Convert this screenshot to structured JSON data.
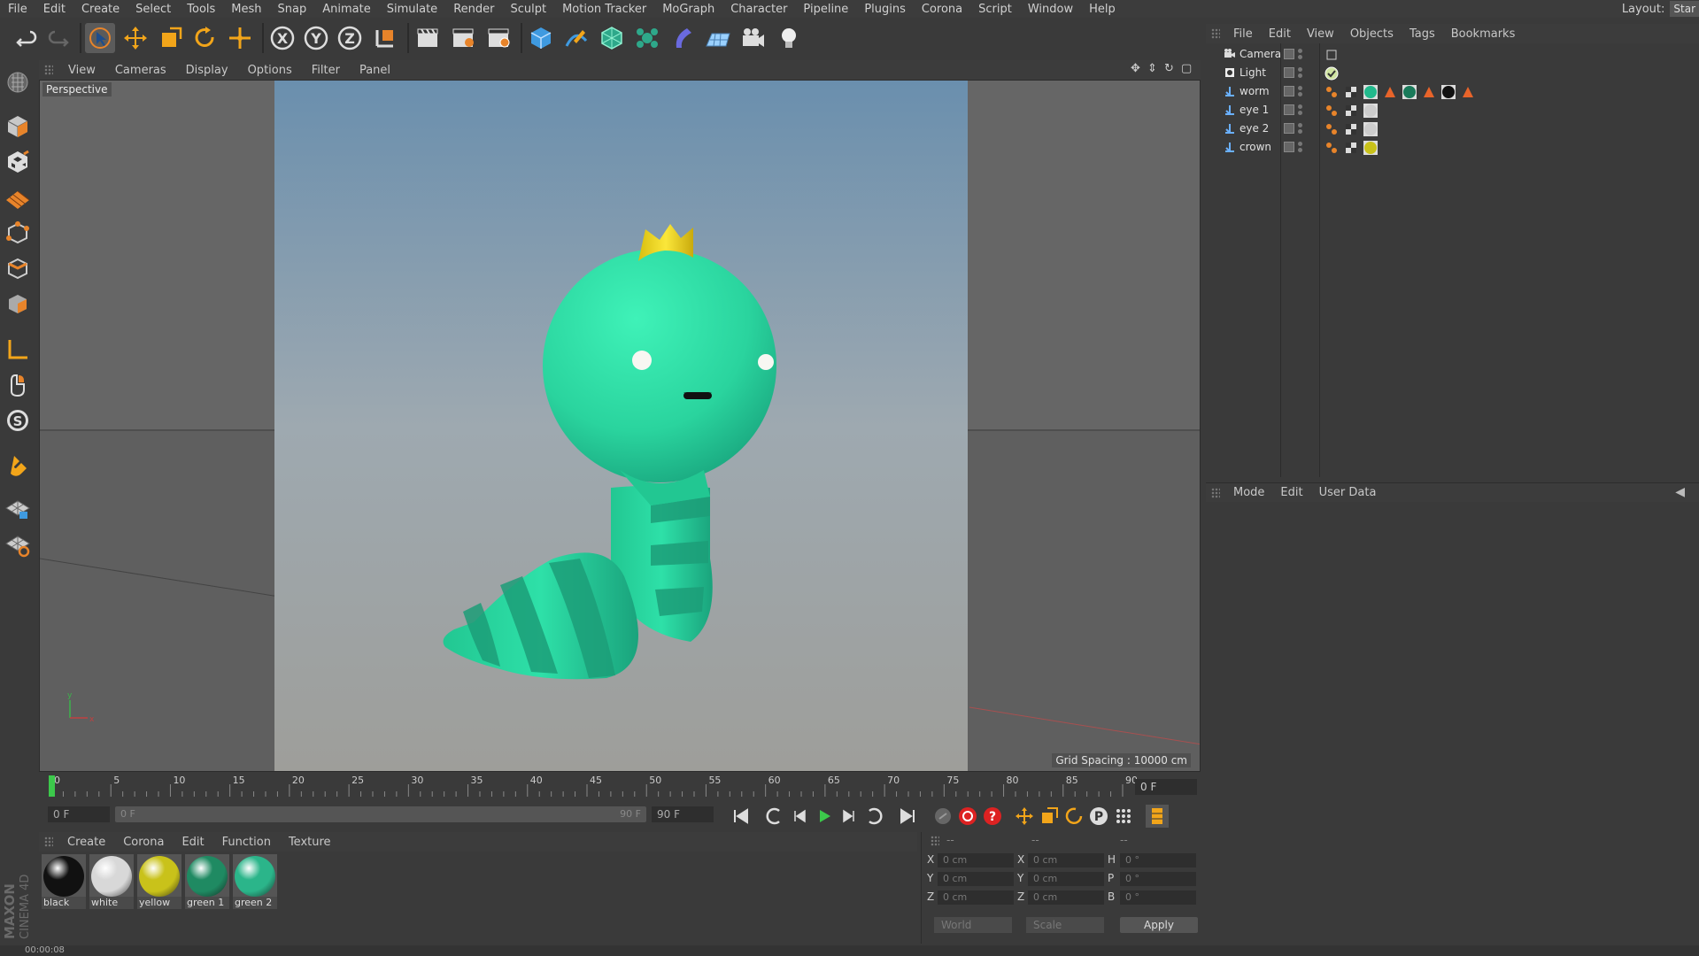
{
  "menubar": {
    "items": [
      "File",
      "Edit",
      "Create",
      "Select",
      "Tools",
      "Mesh",
      "Snap",
      "Animate",
      "Simulate",
      "Render",
      "Sculpt",
      "Motion Tracker",
      "MoGraph",
      "Character",
      "Pipeline",
      "Plugins",
      "Corona",
      "Script",
      "Window",
      "Help"
    ],
    "layout_label": "Layout:",
    "layout_value": "Star"
  },
  "viewport": {
    "menu": [
      "View",
      "Cameras",
      "Display",
      "Options",
      "Filter",
      "Panel"
    ],
    "camera_label": "Perspective",
    "grid_spacing": "Grid Spacing : 10000 cm",
    "colors": {
      "worm": "#2fd6a0",
      "crown": "#f2d81c",
      "sky_top": "#6a8fae",
      "floor": "#8a8a86"
    }
  },
  "timeline": {
    "ticks": [
      "0",
      "5",
      "10",
      "15",
      "20",
      "25",
      "30",
      "35",
      "40",
      "45",
      "50",
      "55",
      "60",
      "65",
      "70",
      "75",
      "80",
      "85",
      "90"
    ],
    "current_frame": "0 F",
    "start_field": "0 F",
    "range_start": "0 F",
    "range_end": "90 F",
    "end_field": "90 F"
  },
  "materials": {
    "menu": [
      "Create",
      "Corona",
      "Edit",
      "Function",
      "Texture"
    ],
    "items": [
      {
        "label": "black",
        "color": "#111111"
      },
      {
        "label": "white",
        "color": "#d8d8d8"
      },
      {
        "label": "yellow",
        "color": "#c9c21a"
      },
      {
        "label": "green 1",
        "color": "#1f8a62"
      },
      {
        "label": "green 2",
        "color": "#2bb58a"
      }
    ]
  },
  "coordinates": {
    "headers": [
      "--",
      "--",
      "--"
    ],
    "pos_labels": [
      "X",
      "Y",
      "Z"
    ],
    "pos_values": [
      "0 cm",
      "0 cm",
      "0 cm"
    ],
    "size_labels": [
      "X",
      "Y",
      "Z"
    ],
    "size_values": [
      "0 cm",
      "0 cm",
      "0 cm"
    ],
    "rot_labels": [
      "H",
      "P",
      "B"
    ],
    "rot_values": [
      "0 °",
      "0 °",
      "0 °"
    ],
    "mode_world": "World",
    "mode_scale": "Scale",
    "apply_label": "Apply"
  },
  "object_manager": {
    "menu": [
      "File",
      "Edit",
      "View",
      "Objects",
      "Tags",
      "Bookmarks"
    ],
    "objects": [
      {
        "name": "Camera",
        "icon": "camera-icon"
      },
      {
        "name": "Light",
        "icon": "light-icon"
      },
      {
        "name": "worm",
        "icon": "null-object-icon"
      },
      {
        "name": "eye 1",
        "icon": "null-object-icon"
      },
      {
        "name": "eye 2",
        "icon": "null-object-icon"
      },
      {
        "name": "crown",
        "icon": "null-object-icon"
      }
    ]
  },
  "attributes": {
    "menu": [
      "Mode",
      "Edit",
      "User Data"
    ]
  },
  "status": {
    "time": "00:00:08"
  }
}
